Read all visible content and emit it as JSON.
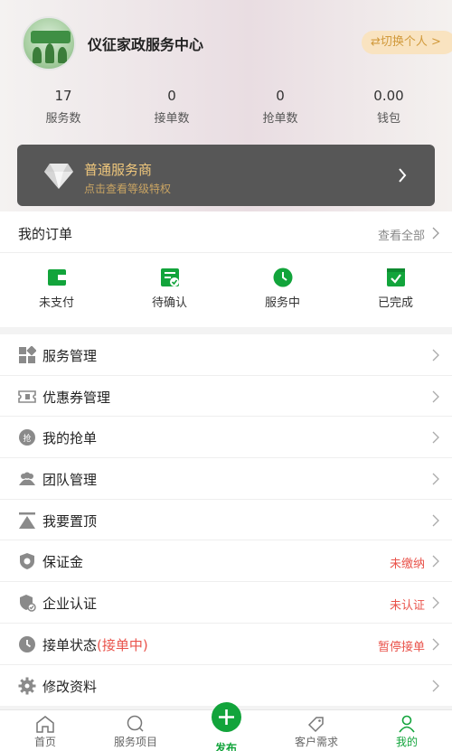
{
  "profile": {
    "name": "仪征家政服务中心",
    "switch_label": "⇄切换个人 >"
  },
  "stats": [
    {
      "value": "17",
      "label": "服务数"
    },
    {
      "value": "0",
      "label": "接单数"
    },
    {
      "value": "0",
      "label": "抢单数"
    },
    {
      "value": "0.00",
      "label": "钱包"
    }
  ],
  "level": {
    "title": "普通服务商",
    "subtitle": "点击查看等级特权"
  },
  "orders": {
    "title": "我的订单",
    "view_all": "查看全部",
    "items": [
      {
        "label": "未支付",
        "icon": "wallet-icon"
      },
      {
        "label": "待确认",
        "icon": "confirm-icon"
      },
      {
        "label": "服务中",
        "icon": "clock-icon"
      },
      {
        "label": "已完成",
        "icon": "check-icon"
      }
    ]
  },
  "menu": [
    {
      "label": "服务管理",
      "icon": "grid-icon",
      "status": ""
    },
    {
      "label": "优惠券管理",
      "icon": "coupon-icon",
      "status": ""
    },
    {
      "label": "我的抢单",
      "icon": "grab-icon",
      "status": ""
    },
    {
      "label": "团队管理",
      "icon": "team-icon",
      "status": ""
    },
    {
      "label": "我要置顶",
      "icon": "pin-top-icon",
      "status": ""
    },
    {
      "label": "保证金",
      "icon": "deposit-icon",
      "status": "未缴纳"
    },
    {
      "label": "企业认证",
      "icon": "shield-icon",
      "status": "未认证"
    },
    {
      "label": "接单状态",
      "label_highlight": "(接单中)",
      "icon": "clock-icon",
      "status": "暂停接单"
    },
    {
      "label": "修改资料",
      "icon": "gear-icon",
      "status": ""
    }
  ],
  "tabbar": [
    {
      "label": "首页",
      "icon": "home-icon"
    },
    {
      "label": "服务项目",
      "icon": "search-icon"
    },
    {
      "label": "发布",
      "icon": "plus-icon"
    },
    {
      "label": "客户需求",
      "icon": "tag-icon"
    },
    {
      "label": "我的",
      "icon": "user-icon"
    }
  ],
  "colors": {
    "accent": "#12a43b",
    "warning": "#e9534b",
    "gold": "#efc77c"
  }
}
